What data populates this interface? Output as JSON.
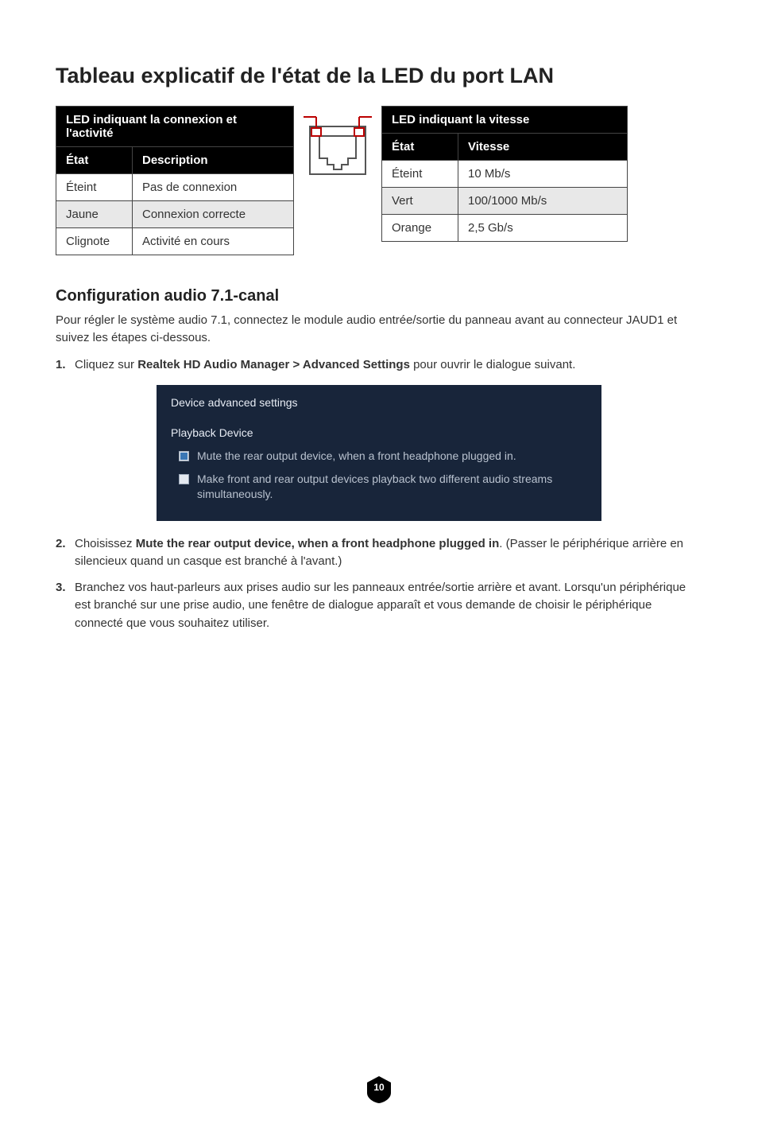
{
  "title": "Tableau explicatif de l'état de la LED du port LAN",
  "table1": {
    "caption": "LED indiquant la connexion et l'activité",
    "headers": [
      "État",
      "Description"
    ],
    "rows": [
      [
        "Éteint",
        "Pas de connexion"
      ],
      [
        "Jaune",
        "Connexion correcte"
      ],
      [
        "Clignote",
        "Activité en cours"
      ]
    ]
  },
  "table2": {
    "caption": "LED indiquant la vitesse",
    "headers": [
      "État",
      "Vitesse"
    ],
    "rows": [
      [
        "Éteint",
        "10 Mb/s"
      ],
      [
        "Vert",
        "100/1000 Mb/s"
      ],
      [
        "Orange",
        "2,5 Gb/s"
      ]
    ]
  },
  "section2": {
    "heading": "Configuration audio 7.1-canal",
    "intro": "Pour régler le système audio 7.1, connectez le module audio entrée/sortie du panneau avant au connecteur JAUD1 et suivez les étapes ci-dessous.",
    "step1_num": "1.",
    "step1_pre": "Cliquez sur ",
    "step1_bold": "Realtek HD Audio Manager > Advanced Settings",
    "step1_post": " pour ouvrir le dialogue suivant.",
    "dialog": {
      "title": "Device advanced settings",
      "section": "Playback Device",
      "opt1": "Mute the rear output device, when a front headphone plugged in.",
      "opt2": "Make front and rear output devices playback two different audio streams simultaneously."
    },
    "step2_num": "2.",
    "step2_pre": "Choisissez ",
    "step2_bold": "Mute the rear output device, when a front headphone plugged in",
    "step2_post": ". (Passer le périphérique arrière en silencieux quand un casque est branché à l'avant.)",
    "step3_num": "3.",
    "step3_text": "Branchez vos haut-parleurs aux prises audio sur les panneaux entrée/sortie arrière et avant. Lorsqu'un périphérique est branché sur une prise audio, une fenêtre de dialogue apparaît et vous demande de choisir le périphérique connecté que vous souhaitez utiliser."
  },
  "pageNumber": "10"
}
